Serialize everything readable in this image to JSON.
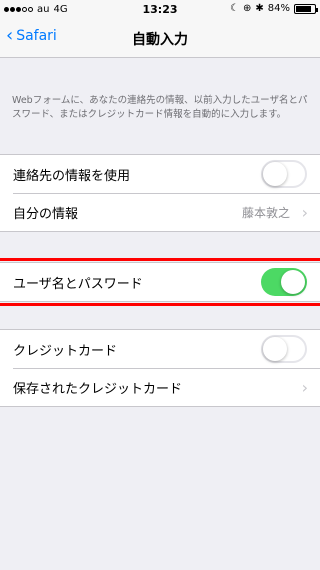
{
  "status_bar": {
    "carrier": "au",
    "network": "4G",
    "time": "13:23",
    "battery": "84%",
    "battery_level": 0.84
  },
  "nav": {
    "back_label": "Safari",
    "title": "自動入力"
  },
  "description": "Webフォームに、あなたの連絡先の情報、以前入力したユーザ名とパスワード、またはクレジットカード情報を自動的に入力します。",
  "group1": {
    "use_contact_label": "連絡先の情報を使用",
    "my_info_label": "自分の情報",
    "my_info_value": "藤本敦之"
  },
  "group2": {
    "names_passwords_label": "ユーザ名とパスワード"
  },
  "group3": {
    "credit_cards_label": "クレジットカード",
    "saved_cards_label": "保存されたクレジットカード"
  },
  "colors": {
    "accent": "#007aff",
    "toggle_on": "#4cd964",
    "highlight": "#ff0000"
  }
}
